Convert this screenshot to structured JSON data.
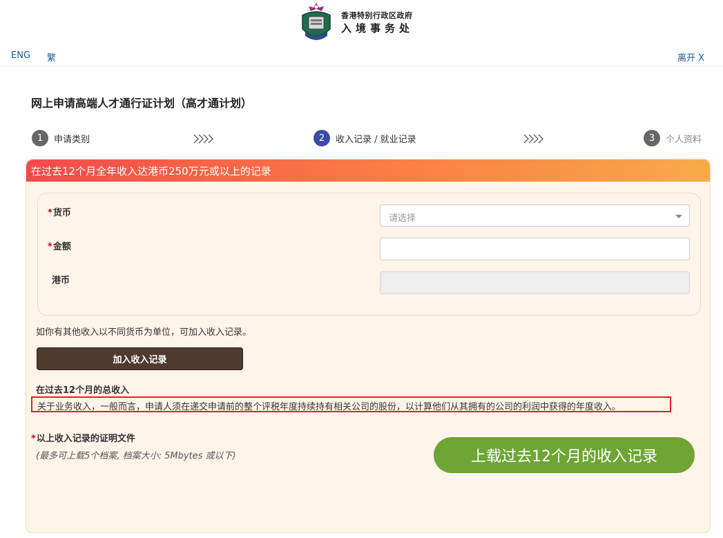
{
  "header": {
    "org_line1": "香港特别行政区政府",
    "org_line2": "入境事务处",
    "lang_eng": "ENG",
    "lang_tc": "繁",
    "exit": "离开 X"
  },
  "page_title": "网上申请高端人才通行证计划（高才通计划）",
  "steps": [
    {
      "num": "1",
      "label": "申请类别"
    },
    {
      "num": "2",
      "label": "收入记录 / 就业记录"
    },
    {
      "num": "3",
      "label": "个人资料"
    }
  ],
  "banner": "在过去12个月全年收入达港币250万元或以上的记录",
  "form": {
    "currency_label": "货币",
    "currency_placeholder": "请选择",
    "amount_label": "金额",
    "hkd_label": "港币",
    "required_mark": "*"
  },
  "hint": "如你有其他收入以不同货币为单位，可加入收入记录。",
  "add_button": "加入收入记录",
  "total_label": "在过去12个月的总收入",
  "notice": "关于业务收入，一般而言，申请人须在递交申请前的整个评税年度持续持有相关公司的股份，以计算他们从其拥有的公司的利润中获得的年度收入。",
  "proof": {
    "label": "以上收入记录的证明文件",
    "sub": "(最多可上载5个档案, 档案大小: 5Mbytes 或以下)"
  },
  "upload_button": "上载过去12个月的收入记录",
  "colors": {
    "step_active": "#3b4aa8",
    "upload_green": "#6ea534",
    "add_brown": "#4e3a2f",
    "notice_border": "#e02020"
  }
}
